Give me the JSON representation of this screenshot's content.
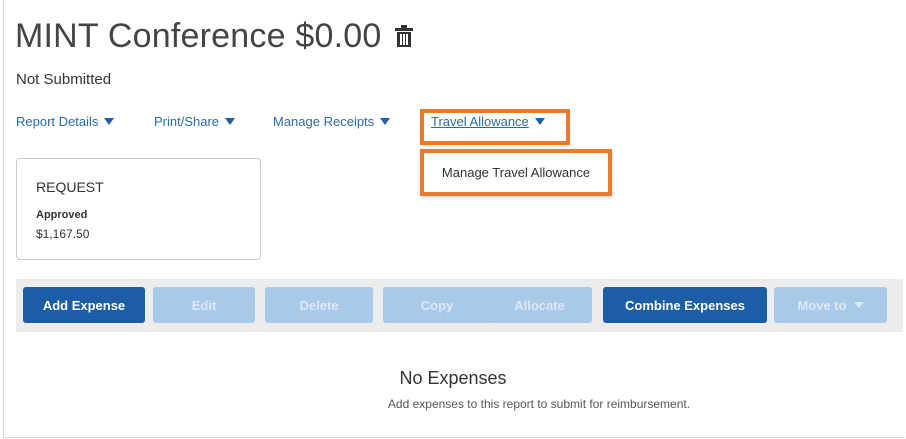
{
  "report": {
    "title": "MINT Conference $0.00",
    "status": "Not Submitted"
  },
  "menu": {
    "items": [
      {
        "label": "Report Details"
      },
      {
        "label": "Print/Share"
      },
      {
        "label": "Manage Receipts"
      },
      {
        "label": "Travel Allowance"
      }
    ],
    "dropdown_item": "Manage Travel Allowance"
  },
  "request_card": {
    "title": "REQUEST",
    "status": "Approved",
    "amount": "$1,167.50"
  },
  "toolbar": {
    "buttons": [
      {
        "label": "Add Expense",
        "state": "enabled"
      },
      {
        "label": "Edit",
        "state": "disabled"
      },
      {
        "label": "Delete",
        "state": "disabled"
      },
      {
        "label": "Copy",
        "state": "disabled"
      },
      {
        "label": "Allocate",
        "state": "disabled"
      },
      {
        "label": "Combine Expenses",
        "state": "enabled"
      },
      {
        "label": "Move to",
        "state": "disabled"
      }
    ]
  },
  "empty_state": {
    "title": "No Expenses",
    "description": "Add expenses to this report to submit for reimbursement."
  },
  "colors": {
    "primary_button": "#1b5ea6",
    "disabled_button": "#a9c9e8",
    "link": "#2a6bad",
    "highlight": "#ea7a2b"
  },
  "icons": {
    "delete_report": "trash-icon",
    "menu_caret": "caret-down-icon"
  }
}
